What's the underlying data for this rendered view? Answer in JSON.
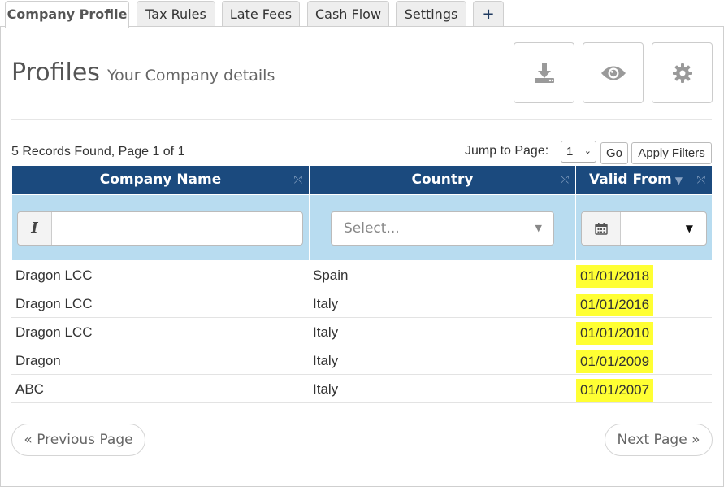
{
  "tabs": [
    {
      "label": "Company Profile",
      "active": true
    },
    {
      "label": "Tax Rules",
      "active": false
    },
    {
      "label": "Late Fees",
      "active": false
    },
    {
      "label": "Cash Flow",
      "active": false
    },
    {
      "label": "Settings",
      "active": false
    }
  ],
  "add_tab_label": "+",
  "header": {
    "title": "Profiles",
    "subtitle": "Your Company details"
  },
  "toolbar_icons": [
    "download-icon",
    "eye-icon",
    "gear-icon"
  ],
  "records_text": "5 Records Found, Page 1 of 1",
  "jump": {
    "label": "Jump to Page:",
    "page": "1",
    "go_label": "Go",
    "apply_label": "Apply Filters"
  },
  "columns": [
    {
      "label": "Company Name"
    },
    {
      "label": "Country"
    },
    {
      "label": "Valid From"
    }
  ],
  "filters": {
    "text_prefix": "I",
    "country_placeholder": "Select..."
  },
  "rows": [
    {
      "company": "Dragon LCC",
      "country": "Spain",
      "valid_from": "01/01/2018"
    },
    {
      "company": "Dragon LCC",
      "country": "Italy",
      "valid_from": "01/01/2016"
    },
    {
      "company": "Dragon LCC",
      "country": "Italy",
      "valid_from": "01/01/2010"
    },
    {
      "company": "Dragon",
      "country": "Italy",
      "valid_from": "01/01/2009"
    },
    {
      "company": "ABC",
      "country": "Italy",
      "valid_from": "01/01/2007"
    }
  ],
  "pager": {
    "prev": "« Previous Page",
    "next": "Next Page »"
  },
  "colors": {
    "header_bg": "#1b4a7e",
    "filter_bg": "#b8dcf0",
    "date_highlight": "#ffff33"
  }
}
